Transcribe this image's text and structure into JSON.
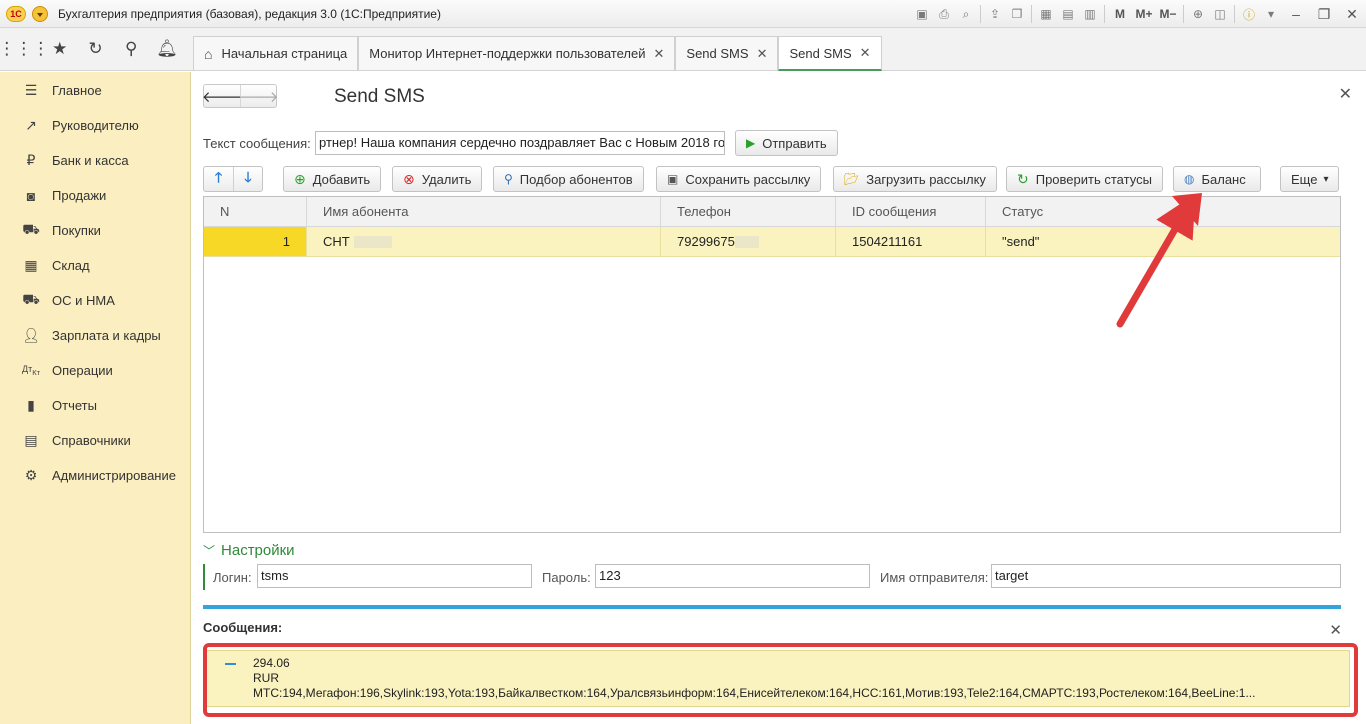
{
  "app": {
    "title": "Бухгалтерия предприятия (базовая), редакция 3.0  (1С:Предприятие)",
    "logo_text": "1С"
  },
  "titlebar_icons": [
    "save-icon",
    "print-icon",
    "preview-icon",
    "upload-icon",
    "copy-icon",
    "calendar-icon",
    "calculator-icon",
    "month-icon"
  ],
  "titlebar_text_buttons": {
    "m": "M",
    "m_plus": "M+",
    "m_minus": "M−"
  },
  "tabs": [
    {
      "label": "Начальная страница",
      "closable": false
    },
    {
      "label": "Монитор Интернет-поддержки пользователей",
      "closable": true
    },
    {
      "label": "Send SMS",
      "closable": true
    },
    {
      "label": "Send SMS",
      "closable": true,
      "active": true
    }
  ],
  "sidebar": {
    "items": [
      {
        "label": "Главное",
        "icon": "menu-icon"
      },
      {
        "label": "Руководителю",
        "icon": "trend-icon"
      },
      {
        "label": "Банк и касса",
        "icon": "ruble-icon"
      },
      {
        "label": "Продажи",
        "icon": "bag-icon"
      },
      {
        "label": "Покупки",
        "icon": "cart-icon"
      },
      {
        "label": "Склад",
        "icon": "warehouse-icon"
      },
      {
        "label": "ОС и НМА",
        "icon": "truck-icon"
      },
      {
        "label": "Зарплата и кадры",
        "icon": "person-icon"
      },
      {
        "label": "Операции",
        "icon": "dt-kt-icon"
      },
      {
        "label": "Отчеты",
        "icon": "bar-chart-icon"
      },
      {
        "label": "Справочники",
        "icon": "book-icon"
      },
      {
        "label": "Администрирование",
        "icon": "gear-icon"
      }
    ]
  },
  "form": {
    "title": "Send SMS",
    "message_label": "Текст сообщения:",
    "message_value": "ртнер! Наша компания сердечно поздравляет Вас с Новым 2018 го",
    "send_label": "Отправить"
  },
  "toolbar": {
    "add": "Добавить",
    "delete": "Удалить",
    "pick": "Подбор абонентов",
    "save": "Сохранить рассылку",
    "load": "Загрузить рассылку",
    "check": "Проверить статусы",
    "balance": "Баланс",
    "more": "Еще"
  },
  "table": {
    "columns": [
      "N",
      "Имя абонента",
      "Телефон",
      "ID сообщения",
      "Статус"
    ],
    "rows": [
      {
        "n": "1",
        "name": "СНТ",
        "phone": "79299675",
        "id": "1504211161",
        "status": "\"send\""
      }
    ]
  },
  "settings": {
    "title": "Настройки",
    "login_label": "Логин:",
    "login_value": "tsms",
    "password_label": "Пароль:",
    "password_value": "123",
    "sender_label": "Имя отправителя:",
    "sender_value": "target"
  },
  "messages": {
    "title": "Сообщения:",
    "line1": "294.06",
    "line2": "RUR",
    "line3": "МТС:194,Мегафон:196,Skylink:193,Yota:193,Байкалвестком:164,Уралсвязьинформ:164,Енисейтелеком:164,НСС:161,Мотив:193,Tele2:164,СМАРТС:193,Ростелеком:164,BeeLine:1..."
  },
  "colors": {
    "sidebar_bg": "#fbeec0",
    "accent_green": "#2f8a3a",
    "accent_blue": "#33a3dc",
    "annotation_red": "#e03a3a",
    "selected_row": "#faf3c0"
  }
}
